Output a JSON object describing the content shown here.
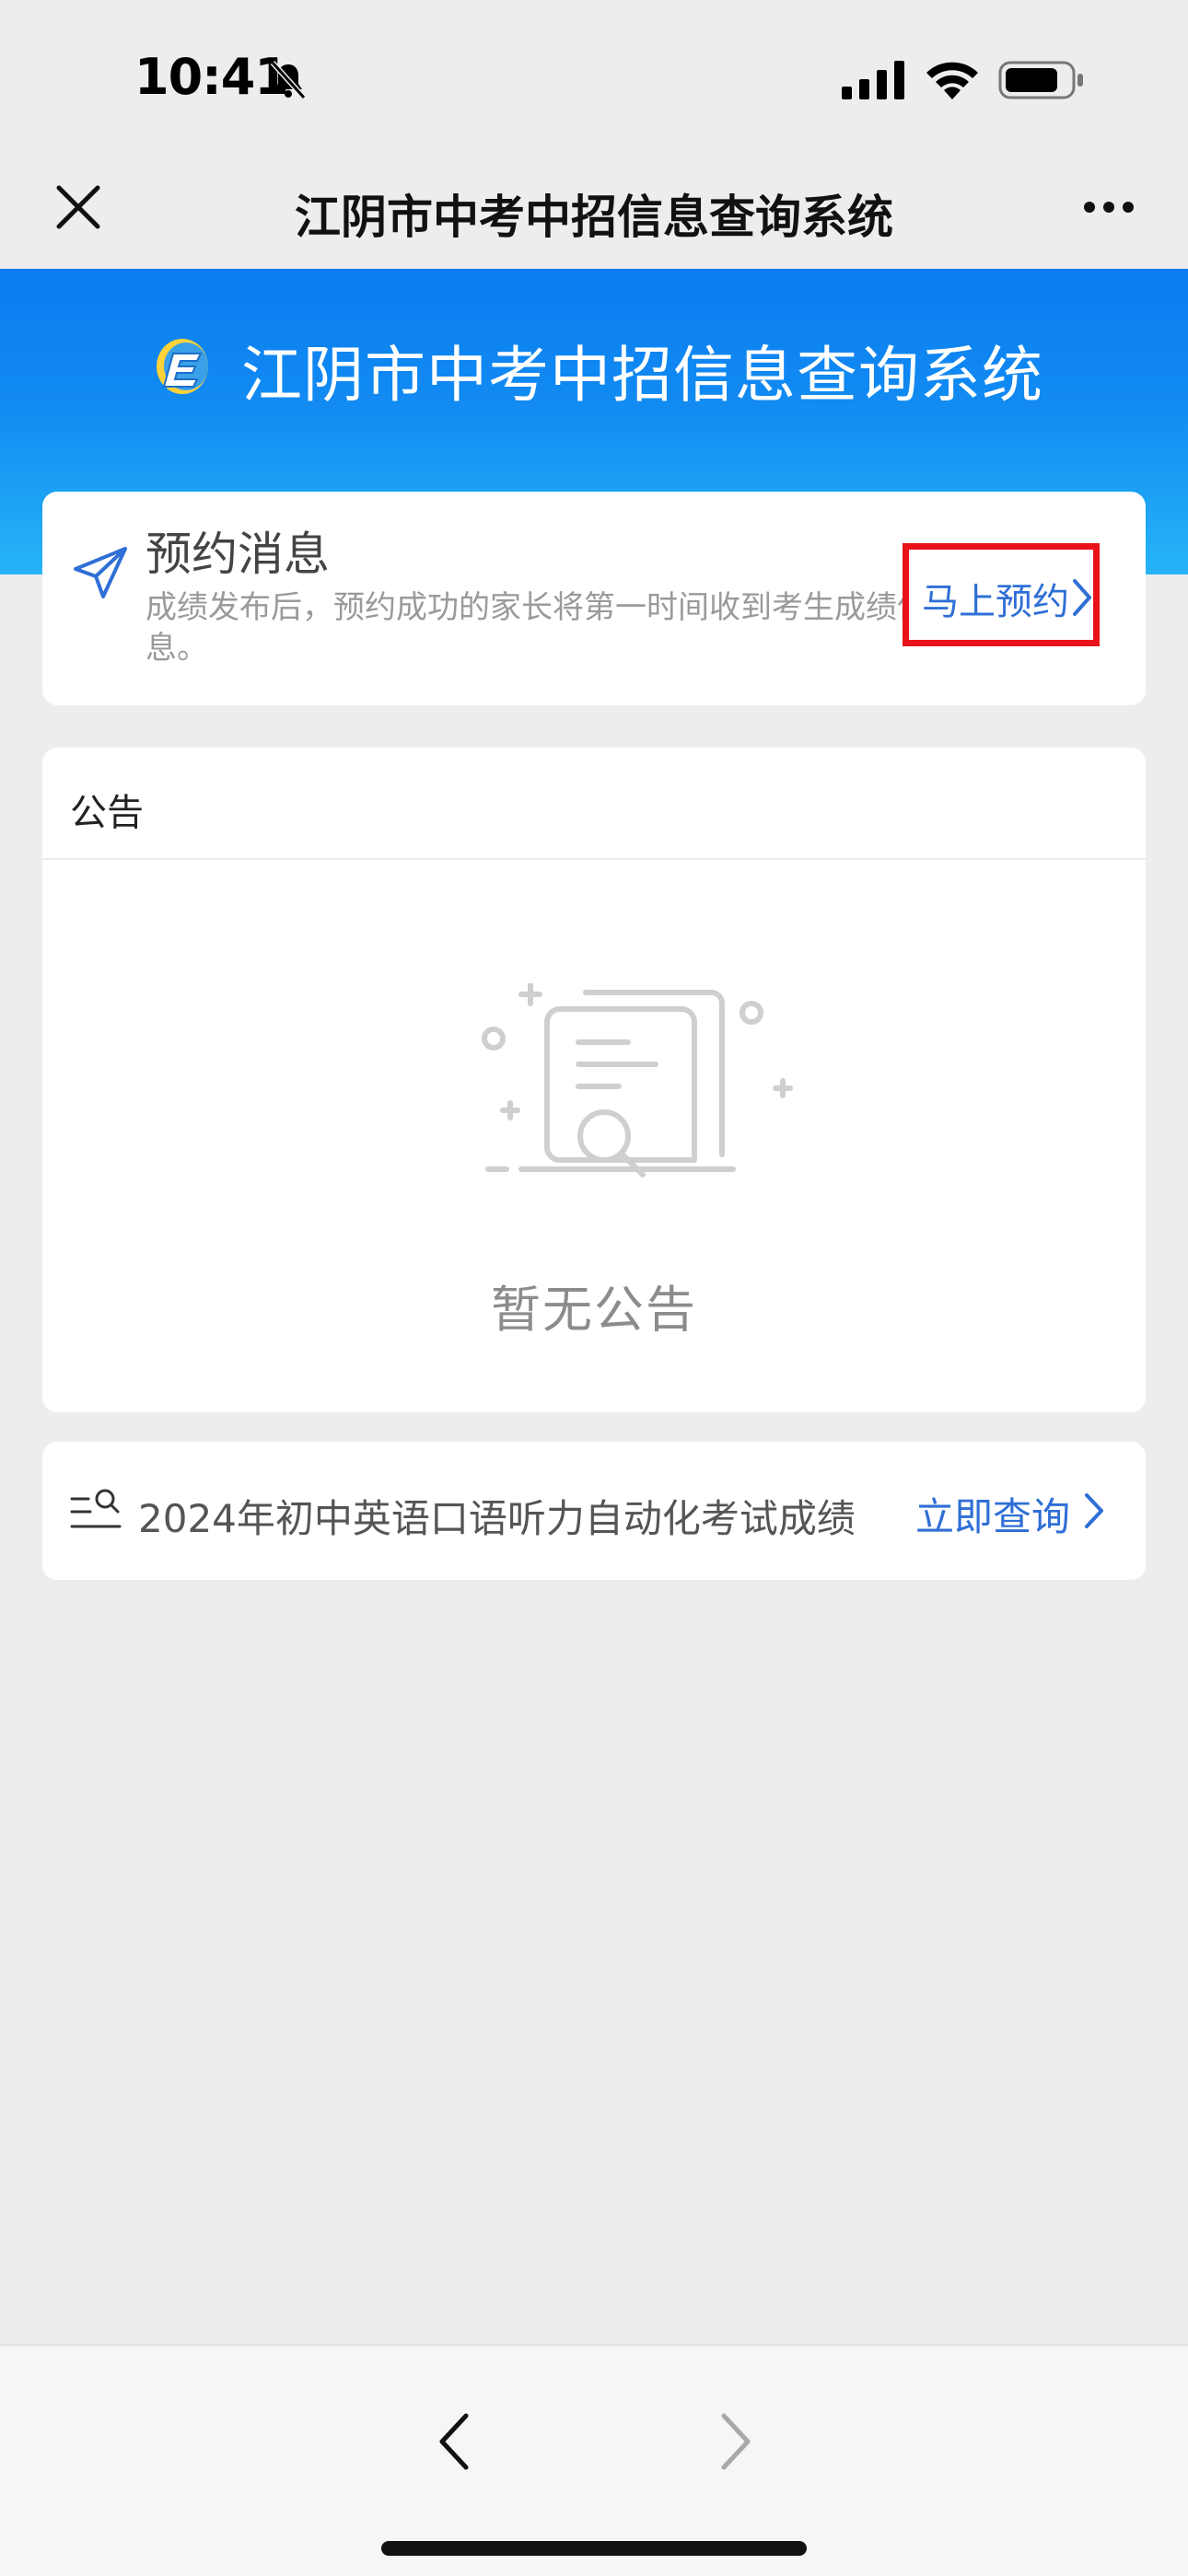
{
  "status_bar": {
    "time": "10:41"
  },
  "nav": {
    "title": "江阴市中考中招信息查询系统"
  },
  "hero": {
    "title": "江阴市中考中招信息查询系统"
  },
  "reserve": {
    "title": "预约消息",
    "description": "成绩发布后，预约成功的家长将第一时间收到考生成绩信息。",
    "button_label": "马上预约"
  },
  "notice": {
    "header": "公告",
    "empty_text": "暂无公告"
  },
  "query": {
    "text": "2024年初中英语口语听力自动化考试成绩",
    "link_label": "立即查询"
  },
  "colors": {
    "accent_blue": "#2f6fd6",
    "hero_gradient_top": "#0a7cf0",
    "hero_gradient_bottom": "#26b4f6",
    "highlight_red": "#e8131a"
  }
}
